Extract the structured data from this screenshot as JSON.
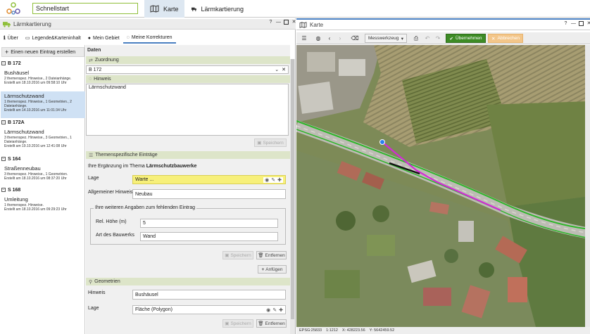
{
  "app": {
    "search_value": "Schnellstart"
  },
  "tabs": [
    {
      "label": "Karte"
    },
    {
      "label": "Lärmkartierung"
    }
  ],
  "left_panel": {
    "title": "Lärmkartierung",
    "subtabs": [
      "Über",
      "Legende&Karteninhalt",
      "Mein Gebiet",
      "Meine Korrekturen"
    ],
    "new_entry_label": "Einen neuen Eintrag erstellen",
    "groups": [
      {
        "name": "B 172",
        "items": [
          {
            "title": "Bushäusel",
            "line1": "2 themenspez. Hinweise., 2 Dateianhänge.",
            "line2": "Erstellt am 18.10.2016 um 09:58:10 Uhr"
          },
          {
            "title": "Lärmschutzwand",
            "line1": "1 themenspez. Hinweise., 1 Geometrien., 2 Dateianhänge.",
            "line2": "Erstellt am 14.10.2016 um 11:01:34 Uhr"
          }
        ]
      },
      {
        "name": "B 172A",
        "items": [
          {
            "title": "Lärmschutzwand",
            "line1": "3 themenspez. Hinweise., 3 Geometrien., 1 Dateianhänge.",
            "line2": "Erstellt am 19.10.2016 um 12:41:08 Uhr"
          }
        ]
      },
      {
        "name": "S 164",
        "items": [
          {
            "title": "Straßenneubau",
            "line1": "3 themenspez. Hinweise., 1 Geometrien.",
            "line2": "Erstellt am 18.10.2016 um 08:37:20 Uhr"
          }
        ]
      },
      {
        "name": "S 168",
        "items": [
          {
            "title": "Umleitung",
            "line1": "1 themenspez. Hinweise.",
            "line2": "Erstellt am 18.10.2016 um 09:29:23 Uhr"
          }
        ]
      }
    ],
    "form": {
      "daten_label": "Daten",
      "zuordnung_label": "Zuordnung",
      "zuordnung_value": "B 172",
      "hinweis_label": "Hinweis",
      "hinweis_value": "Lärmschutzwand",
      "speichern_label": "Speichern",
      "themen_label": "Themenspezifische Einträge",
      "ergaenzung_prefix": "Ihre Ergänzung im Thema",
      "ergaenzung_thema": "Lärmschutzbauwerke",
      "lage_label": "Lage",
      "lage_value": "Warte ...",
      "allg_hinweis_label": "Allgemeiner Hinweis",
      "allg_hinweis_value": "Neubau",
      "weitere_label": "Ihre weiteren Angaben zum fehlenden Eintrag",
      "rel_hoehe_label": "Rel. Höhe (m)",
      "rel_hoehe_value": "5",
      "art_label": "Art des Bauwerks",
      "art_value": "Wand",
      "entfernen_label": "Entfernen",
      "anfuegen_label": "Anfügen",
      "geometrien_label": "Geometrien",
      "geo_hinweis_label": "Hinweis",
      "geo_hinweis_value": "Bushäusel",
      "geo_lage_label": "Lage",
      "geo_lage_value": "Fläche (Polygon)"
    }
  },
  "map_panel": {
    "title": "Karte",
    "messwerkzeug_label": "Messwerkzeug",
    "uebernehmen_label": "Übernehmen",
    "abbrechen_label": "Abbrechen",
    "status": {
      "epsg": "EPSG:25833",
      "scale": "1:1212",
      "x": "X: 428223.56",
      "y": "Y: 5642459.52"
    }
  },
  "colors": {
    "accent_green": "#8fbf3a",
    "selected": "#cfe1f4",
    "section": "#dde5c9",
    "ok_button": "#3d8b25",
    "cancel_button": "#f3c68a"
  }
}
